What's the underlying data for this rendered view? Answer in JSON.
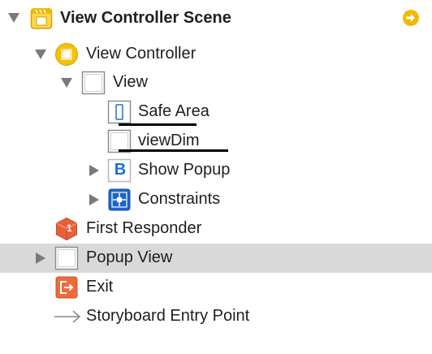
{
  "outline": {
    "scene": {
      "label": "View Controller Scene",
      "accent": "#f5b800"
    },
    "view_controller": {
      "label": "View Controller"
    },
    "view": {
      "label": "View"
    },
    "safe_area": {
      "label": "Safe Area"
    },
    "view_dim": {
      "label": "viewDim"
    },
    "show_popup": {
      "label": "Show Popup",
      "icon_glyph": "B"
    },
    "constraints": {
      "label": "Constraints"
    },
    "first_responder": {
      "label": "First Responder",
      "badge": "1"
    },
    "popup_view": {
      "label": "Popup View"
    },
    "exit": {
      "label": "Exit"
    },
    "entry_point": {
      "label": "Storyboard Entry Point"
    }
  },
  "colors": {
    "selection": "#d9d9d9",
    "disclosure": "#7a7a7a",
    "segue_blue": "#1d6fd6",
    "responder_orange": "#e8603a",
    "exit_orange": "#ef6a3a"
  }
}
